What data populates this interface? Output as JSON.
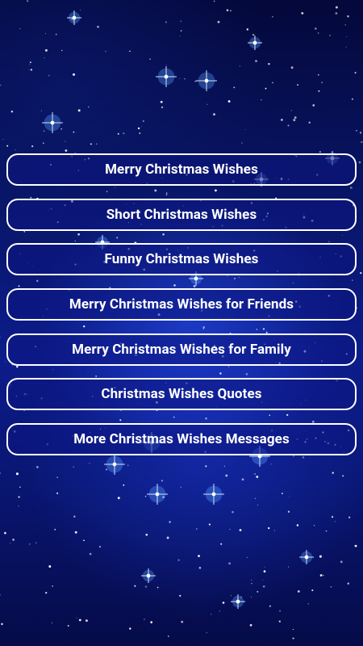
{
  "background": {
    "image": "starry-night-sky",
    "base_color": "#081565",
    "accent_color": "#2a50f0"
  },
  "menu": {
    "items": [
      {
        "label": "Merry Christmas Wishes"
      },
      {
        "label": "Short Christmas Wishes"
      },
      {
        "label": "Funny Christmas Wishes"
      },
      {
        "label": "Merry Christmas Wishes for Friends"
      },
      {
        "label": "Merry Christmas Wishes for Family"
      },
      {
        "label": "Christmas Wishes Quotes"
      },
      {
        "label": "More Christmas Wishes Messages"
      }
    ]
  }
}
